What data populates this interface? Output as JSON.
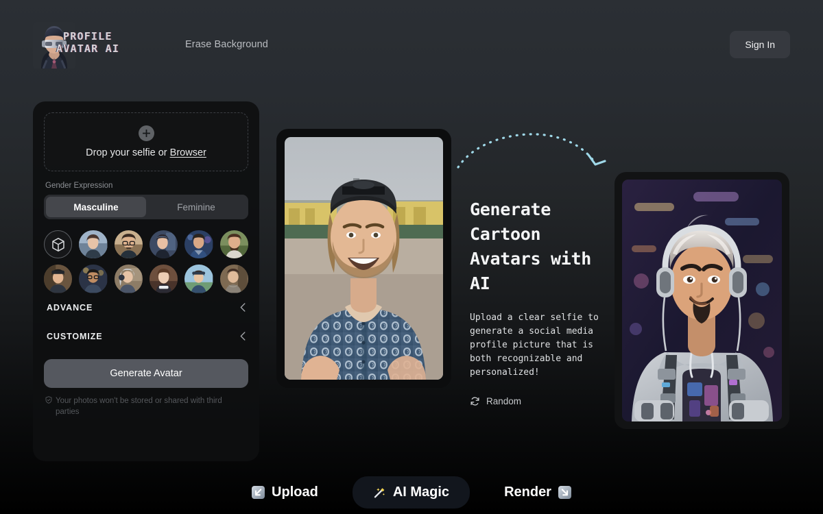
{
  "header": {
    "brand_line1": "PROFILE",
    "brand_line2": "AVATAR AI",
    "brand_icon": "vr-headset-avatar-logo",
    "nav_link": "Erase Background",
    "signin_label": "Sign In"
  },
  "panel": {
    "drop": {
      "icon": "plus-icon",
      "text_prefix": "Drop your selfie or ",
      "link": "Browser"
    },
    "gender": {
      "label": "Gender Expression",
      "options": [
        "Masculine",
        "Feminine"
      ],
      "selected": "Masculine"
    },
    "styles": {
      "first_icon": "cube-3d-icon",
      "items": [
        {
          "name": "style-random-cube",
          "selected": true
        },
        {
          "name": "style-woman-brown-hair"
        },
        {
          "name": "style-man-glasses-mustache"
        },
        {
          "name": "style-woman-headset"
        },
        {
          "name": "style-man-blue-jacket"
        },
        {
          "name": "style-man-beard-smile"
        },
        {
          "name": "style-woman-cap"
        },
        {
          "name": "style-man-glasses-beard"
        },
        {
          "name": "style-woman-grey-hair-headphones"
        },
        {
          "name": "style-woman-collar"
        },
        {
          "name": "style-boy-outdoors"
        },
        {
          "name": "style-woman-scarf"
        }
      ]
    },
    "accordions": [
      {
        "label": "ADVANCE",
        "chevron": "chevron-left-icon"
      },
      {
        "label": "CUSTOMIZE",
        "chevron": "chevron-left-icon"
      }
    ],
    "generate_label": "Generate Avatar",
    "privacy": {
      "icon": "shield-check-icon",
      "text": "Your photos won't be stored or shared with third parties"
    }
  },
  "showcase": {
    "source_photo_alt": "smiling-man-backwards-cap-patterned-shirt",
    "arrow": "dashed-curved-arrow",
    "arrow_color": "#9fd8e8",
    "headline": "Generate Cartoon Avatars with AI",
    "body": "Upload a clear selfie to generate a social media profile picture that is both recognizable and personalized!",
    "random": {
      "icon": "refresh-icon",
      "label": "Random"
    },
    "result_avatar_alt": "3d-cartoon-avatar-headphones-hoodie-neon-background"
  },
  "bottombar": {
    "items": [
      {
        "label": "Upload",
        "icon": "arrow-down-left-emoji",
        "icon_position": "left",
        "pill": false
      },
      {
        "label": "AI Magic",
        "icon": "magic-wand-emoji",
        "icon_position": "left",
        "pill": true
      },
      {
        "label": "Render",
        "icon": "arrow-down-right-emoji",
        "icon_position": "right",
        "pill": false
      }
    ]
  },
  "colors": {
    "page_top": "#2b2f34",
    "page_bottom": "#000000",
    "panel": "#0e0f10",
    "accent_arrow": "#9fd8e8",
    "button": "#55585f",
    "pill": "#12161d"
  }
}
